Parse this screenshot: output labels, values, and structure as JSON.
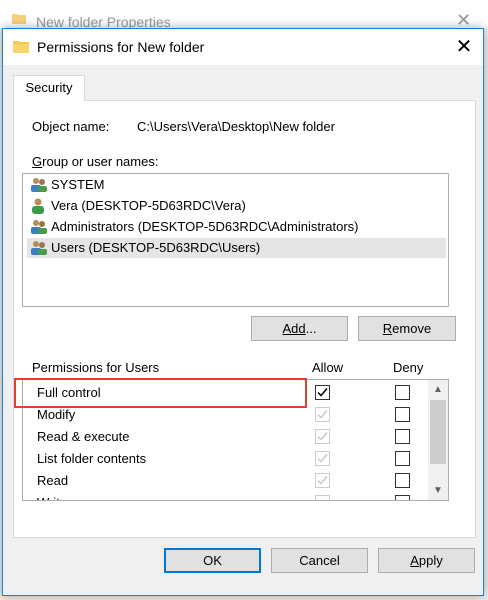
{
  "background_window": {
    "title": "New folder Properties"
  },
  "dialog": {
    "title": "Permissions for New folder",
    "tab": "Security",
    "object_name_label": "Object name:",
    "object_name_value": "C:\\Users\\Vera\\Desktop\\New folder",
    "group_label": "Group or user names:",
    "users": [
      {
        "name": "SYSTEM",
        "icon": "group-users-icon"
      },
      {
        "name": "Vera (DESKTOP-5D63RDC\\Vera)",
        "icon": "single-user-icon"
      },
      {
        "name": "Administrators (DESKTOP-5D63RDC\\Administrators)",
        "icon": "group-users-icon"
      },
      {
        "name": "Users (DESKTOP-5D63RDC\\Users)",
        "icon": "group-users-icon",
        "selected": true
      }
    ],
    "add_button": "Add...",
    "remove_button": "Remove",
    "permissions_label": "Permissions for Users",
    "allow_header": "Allow",
    "deny_header": "Deny",
    "permissions": [
      {
        "name": "Full control",
        "allow": true,
        "allow_enabled": true,
        "deny": false
      },
      {
        "name": "Modify",
        "allow": true,
        "allow_enabled": false,
        "deny": false
      },
      {
        "name": "Read & execute",
        "allow": true,
        "allow_enabled": false,
        "deny": false
      },
      {
        "name": "List folder contents",
        "allow": true,
        "allow_enabled": false,
        "deny": false
      },
      {
        "name": "Read",
        "allow": true,
        "allow_enabled": false,
        "deny": false
      },
      {
        "name": "Write",
        "allow": true,
        "allow_enabled": false,
        "deny": false
      }
    ],
    "ok_button": "OK",
    "cancel_button": "Cancel",
    "apply_button": "Apply"
  },
  "colors": {
    "accent": "#0078d7",
    "highlight": "#e0402e",
    "folder": "#f5c94c"
  }
}
